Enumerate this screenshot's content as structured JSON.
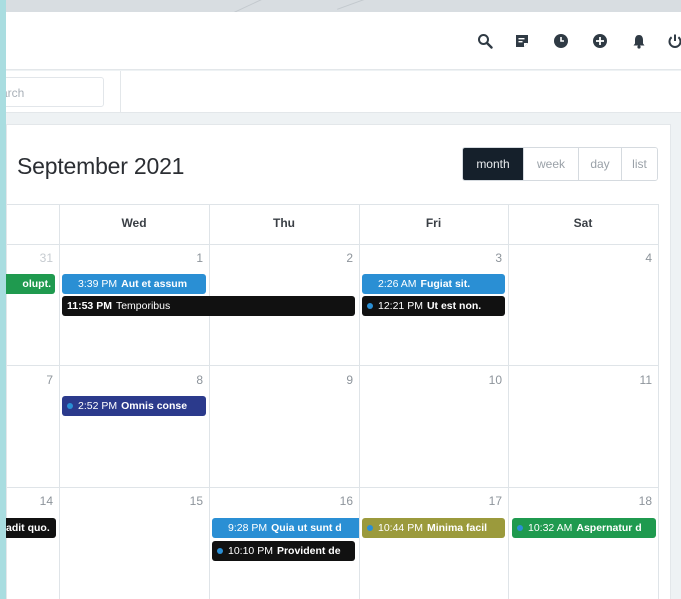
{
  "topbar": {
    "icons": [
      "search-icon",
      "notes-icon",
      "clock-icon",
      "add-circle-icon",
      "bell-icon",
      "power-icon"
    ]
  },
  "search": {
    "placeholder": "Search",
    "visible_text": "arch"
  },
  "calendar": {
    "title": "September 2021",
    "views": [
      "month",
      "week",
      "day",
      "list"
    ],
    "active_view": "month",
    "weekdays": [
      "Wed",
      "Thu",
      "Fri",
      "Sat"
    ],
    "weeks": [
      [
        "31",
        "1",
        "2",
        "3",
        "4"
      ],
      [
        "7",
        "8",
        "9",
        "10",
        "11"
      ],
      [
        "14",
        "15",
        "16",
        "17",
        "18"
      ]
    ],
    "events": {
      "w1_green": {
        "time": "",
        "title": "olupt."
      },
      "w1_wed": {
        "time": "3:39 PM",
        "title": "Aut et assum"
      },
      "w1_span": {
        "time": "11:53 PM",
        "title": "Temporibus"
      },
      "w1_fri_a": {
        "time": "2:26 AM",
        "title": "Fugiat sit."
      },
      "w1_fri_b": {
        "time": "12:21 PM",
        "title": "Ut est non."
      },
      "w2_wed": {
        "time": "2:52 PM",
        "title": "Omnis conse"
      },
      "w3_black": {
        "time": "",
        "title": "adit quo."
      },
      "w3_thu_a": {
        "time": "9:28 PM",
        "title": "Quia ut sunt d"
      },
      "w3_thu_b": {
        "time": "10:10 PM",
        "title": "Provident de"
      },
      "w3_fri": {
        "time": "10:44 PM",
        "title": "Minima facil"
      },
      "w3_sat": {
        "time": "10:32 AM",
        "title": "Aspernatur d"
      }
    }
  },
  "colors": {
    "blue": "#2a8fd4",
    "black": "#111111",
    "navy": "#2b3a8c",
    "olive": "#9b9a3c",
    "green": "#1f9a4f",
    "accent_bg": "#15202b"
  }
}
